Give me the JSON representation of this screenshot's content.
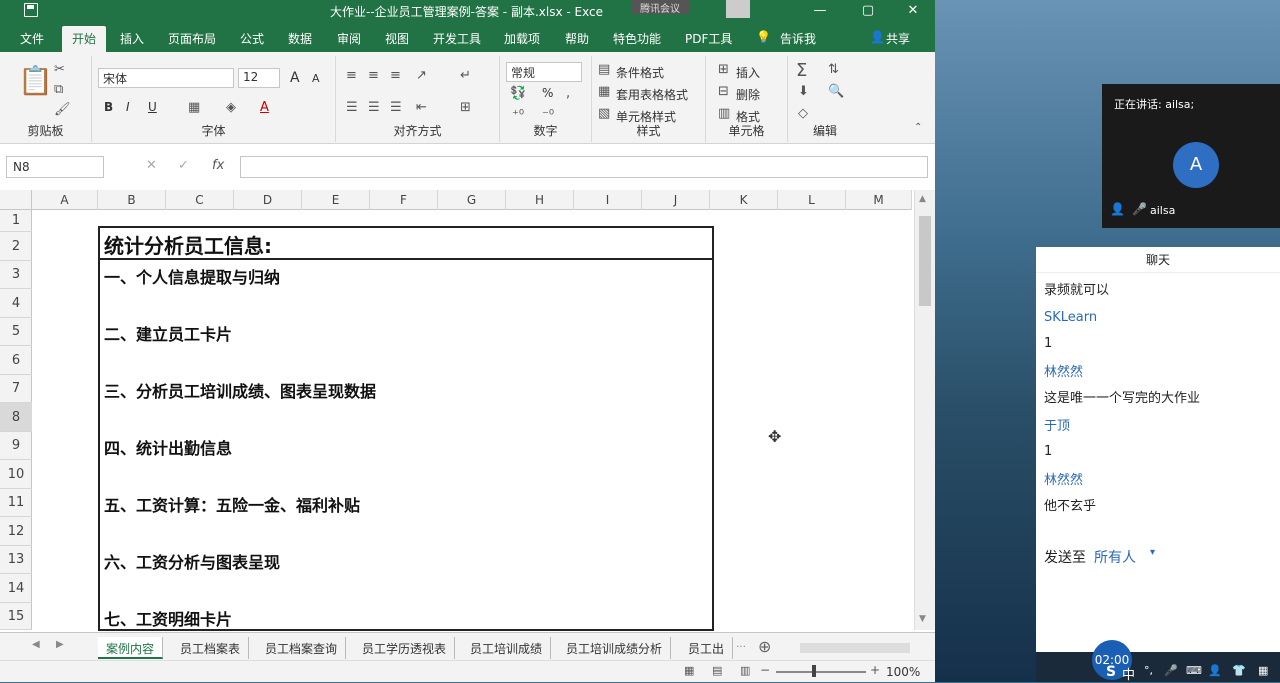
{
  "window": {
    "title": "大作业--企业员工管理案例-答案 - 副本.xlsx  -  Exce",
    "controls": [
      "—",
      "▢",
      "✕"
    ]
  },
  "menu": {
    "tabs": [
      "文件",
      "开始",
      "插入",
      "页面布局",
      "公式",
      "数据",
      "审阅",
      "视图",
      "开发工具",
      "加载项",
      "帮助",
      "特色功能",
      "PDF工具"
    ],
    "active_tab": "开始",
    "tell_me": "告诉我",
    "share": "共享"
  },
  "ribbon": {
    "clipboard_label": "剪贴板",
    "font_name": "宋体",
    "font_size": "12",
    "font_label": "字体",
    "bold": "B",
    "italic": "I",
    "underline": "U",
    "grow_font": "A",
    "shrink_font": "A",
    "align_label": "对齐方式",
    "number_format": "常规",
    "percent": "%",
    "number_label": "数字",
    "cond_format": "条件格式",
    "table_format": "套用表格格式",
    "cell_style": "单元格样式",
    "style_label": "样式",
    "insert": "插入",
    "delete": "删除",
    "format": "格式",
    "cells_label": "单元格",
    "edit_label": "编辑"
  },
  "formula_bar": {
    "name_box": "N8",
    "fx": "fx",
    "cancel": "✕",
    "confirm": "✓",
    "value": ""
  },
  "columns": [
    "A",
    "B",
    "C",
    "D",
    "E",
    "F",
    "G",
    "H",
    "I",
    "J",
    "K",
    "L",
    "M"
  ],
  "rows": [
    "1",
    "2",
    "3",
    "4",
    "5",
    "6",
    "7",
    "8",
    "9",
    "10",
    "11",
    "12",
    "13",
    "14",
    "15"
  ],
  "sheet": {
    "headline": "统计分析员工信息:",
    "items": [
      "一、个人信息提取与归纳",
      "二、建立员工卡片",
      "三、分析员工培训成绩、图表呈现数据",
      "四、统计出勤信息",
      "五、工资计算：五险一金、福利补贴",
      "六、工资分析与图表呈现",
      "七、工资明细卡片"
    ]
  },
  "sheet_tabs": [
    "案例内容",
    "员工档案表",
    "员工档案查询",
    "员工学历透视表",
    "员工培训成绩",
    "员工培训成绩分析",
    "员工出"
  ],
  "active_sheet": "案例内容",
  "status": {
    "zoom": "100%"
  },
  "meeting": {
    "overlay": "腾讯会议",
    "speaking": "正在讲话: ailsa;",
    "avatar_letter": "A",
    "participant": "ailsa",
    "chat_title": "聊天",
    "messages": [
      {
        "sender": "",
        "text": "录频就可以"
      },
      {
        "sender": "SKLearn",
        "text": "1"
      },
      {
        "sender": "林然然",
        "text": "这是唯一一个写完的大作业"
      },
      {
        "sender": "于顶",
        "text": "1"
      },
      {
        "sender": "林然然",
        "text": "他不玄乎"
      }
    ],
    "send_to_label": "发送至",
    "send_to_target": "所有人",
    "clock": "02:00",
    "ime": "中"
  },
  "colors": {
    "excel_green": "#217346",
    "chat_name": "#2a6ab8"
  }
}
